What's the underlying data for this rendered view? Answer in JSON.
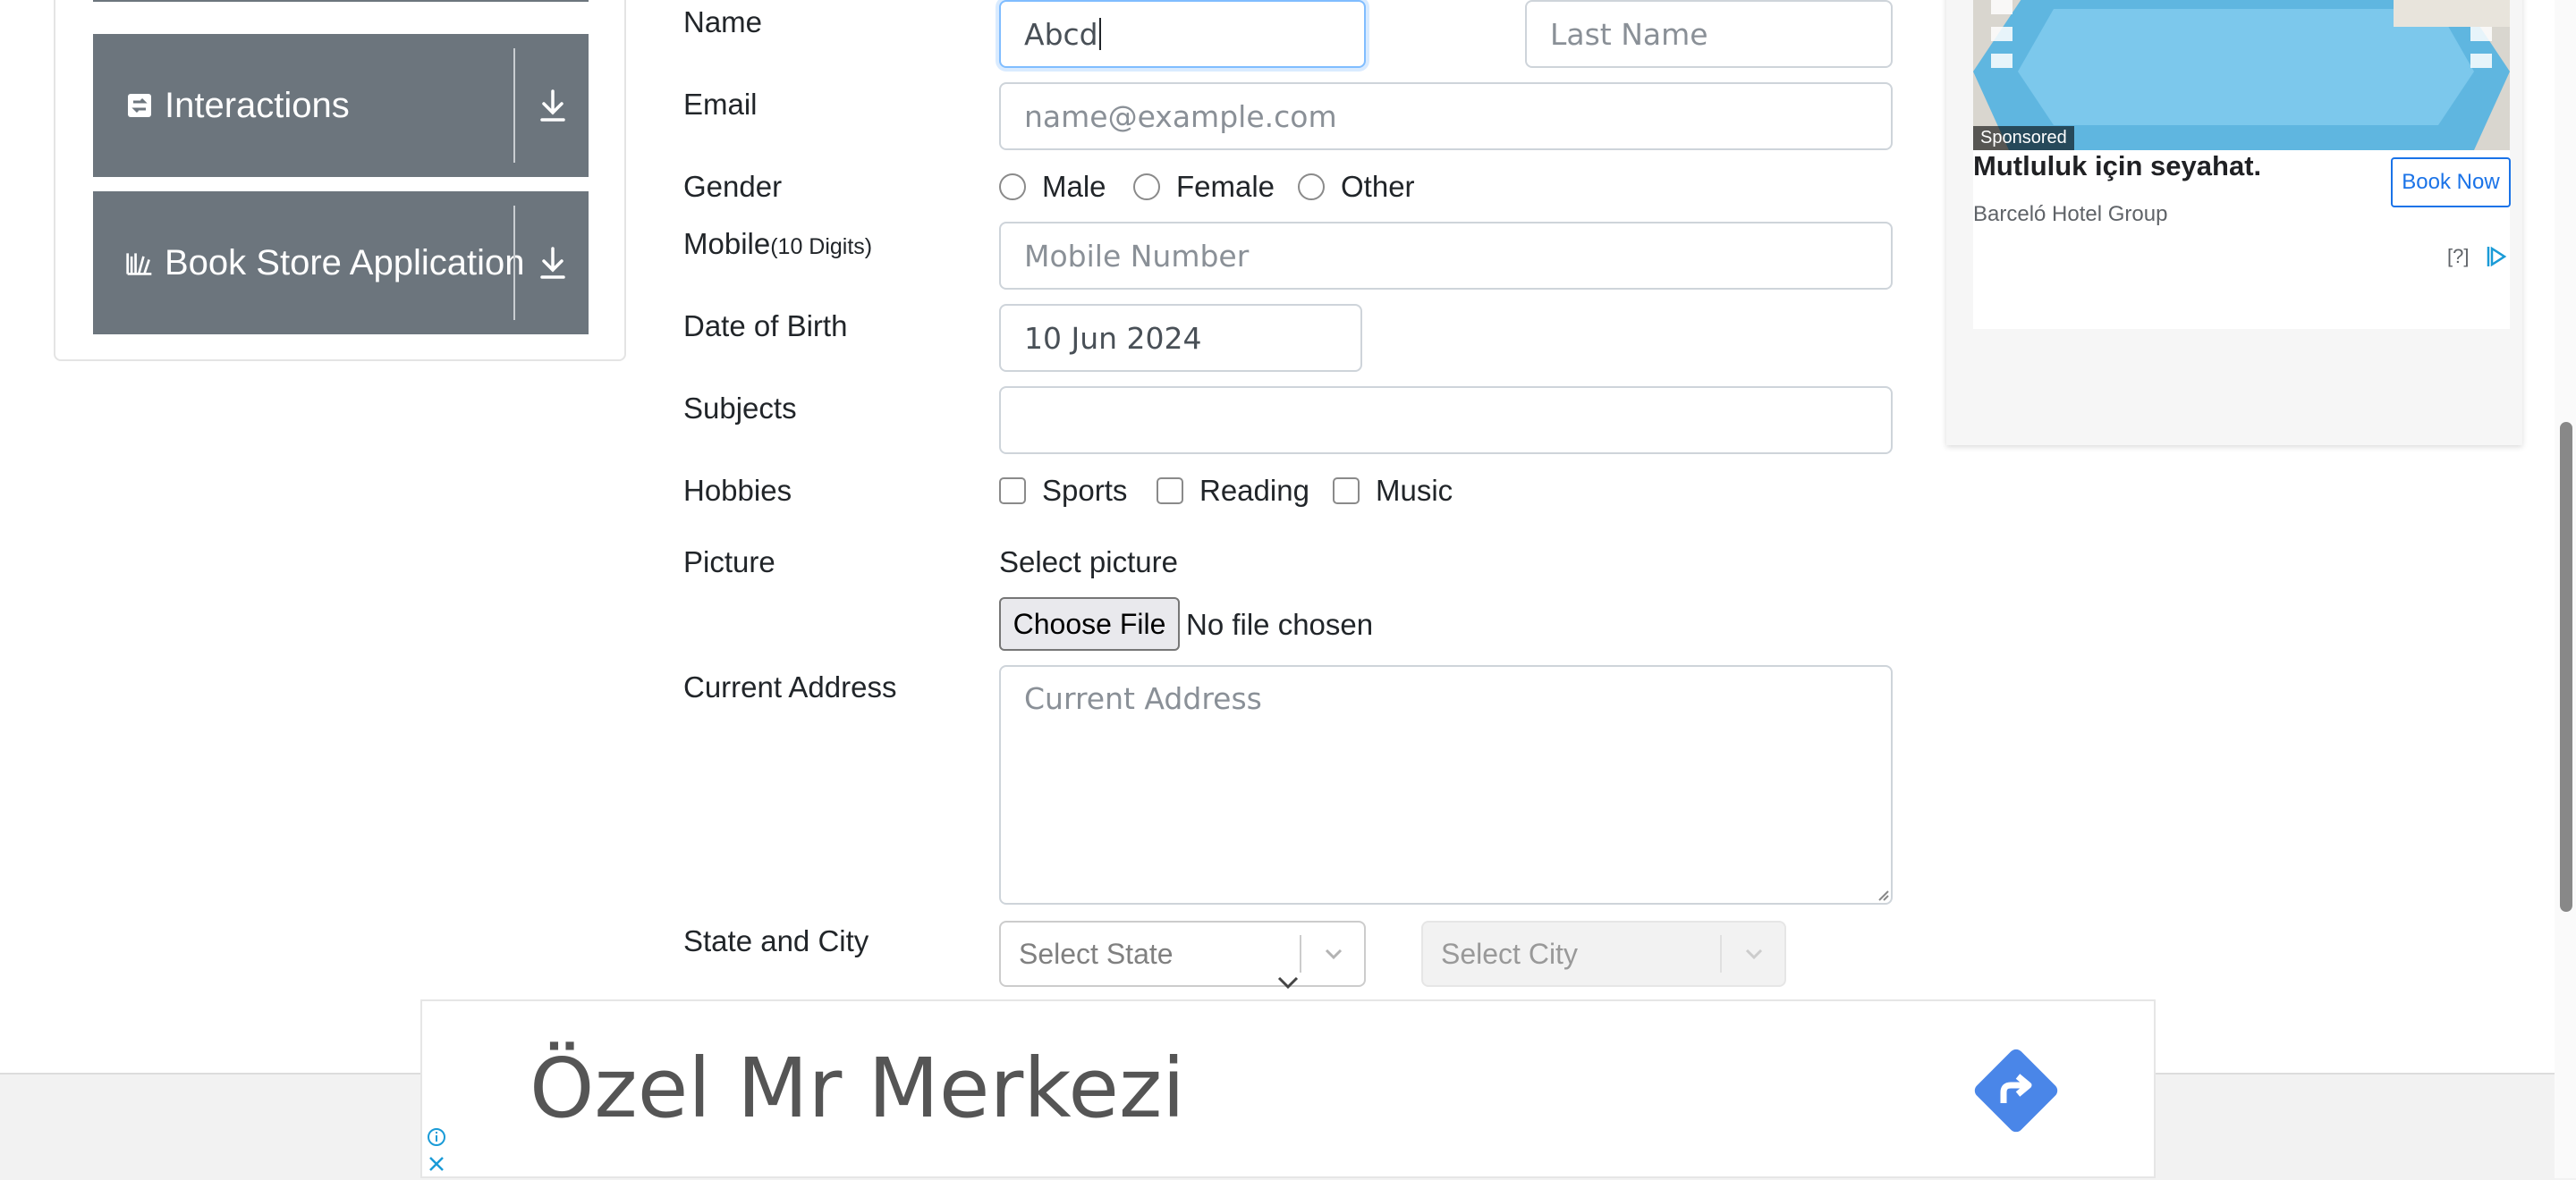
{
  "sidebar": {
    "items": [
      {
        "label": "Interactions",
        "icon": "interactions-icon"
      },
      {
        "label": "Book Store Application",
        "icon": "books-icon"
      }
    ]
  },
  "form": {
    "name_label": "Name",
    "first_name_value": "Abcd",
    "last_name_placeholder": "Last Name",
    "email_label": "Email",
    "email_placeholder": "name@example.com",
    "gender_label": "Gender",
    "gender_options": [
      "Male",
      "Female",
      "Other"
    ],
    "mobile_label": "Mobile",
    "mobile_hint": "(10 Digits)",
    "mobile_placeholder": "Mobile Number",
    "dob_label": "Date of Birth",
    "dob_value": "10 Jun 2024",
    "subjects_label": "Subjects",
    "hobbies_label": "Hobbies",
    "hobbies_options": [
      "Sports",
      "Reading",
      "Music"
    ],
    "picture_label": "Picture",
    "picture_prompt": "Select picture",
    "choose_file_label": "Choose File",
    "no_file_text": "No file chosen",
    "address_label": "Current Address",
    "address_placeholder": "Current Address",
    "state_city_label": "State and City",
    "state_placeholder": "Select State",
    "city_placeholder": "Select City"
  },
  "ad_right": {
    "sponsored": "Sponsored",
    "title": "Mutluluk için seyahat.",
    "cta": "Book Now",
    "brand": "Barceló Hotel Group",
    "info": "[?]"
  },
  "ad_bottom": {
    "text": "Özel Mr Merkezi",
    "accent": "#4a86e8"
  }
}
